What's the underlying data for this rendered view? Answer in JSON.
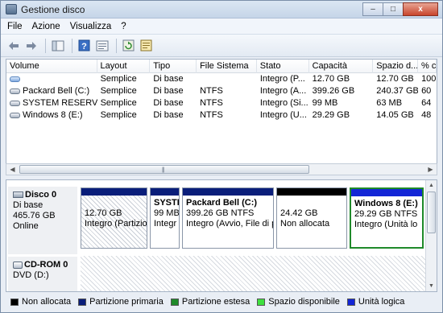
{
  "window": {
    "title": "Gestione disco",
    "min": "–",
    "max": "□",
    "close": "x"
  },
  "menu": [
    "File",
    "Azione",
    "Visualizza",
    "?"
  ],
  "toolbar": {
    "icons": [
      "back-arrow-icon",
      "forward-arrow-icon",
      "console-tree-icon",
      "help-icon",
      "properties-icon",
      "refresh-icon",
      "export-list-icon"
    ]
  },
  "volumes": {
    "headers": [
      "Volume",
      "Layout",
      "Tipo",
      "File Sistema",
      "Stato",
      "Capacità",
      "Spazio d...",
      "% c"
    ],
    "rows": [
      [
        "",
        "Semplice",
        "Di base",
        "",
        "Integro (P...",
        "12.70 GB",
        "12.70 GB",
        "100"
      ],
      [
        "Packard Bell (C:)",
        "Semplice",
        "Di base",
        "NTFS",
        "Integro (A...",
        "399.26 GB",
        "240.37 GB",
        "60"
      ],
      [
        "SYSTEM RESERVED",
        "Semplice",
        "Di base",
        "NTFS",
        "Integro (Si...",
        "99 MB",
        "63 MB",
        "64"
      ],
      [
        "Windows 8 (E:)",
        "Semplice",
        "Di base",
        "NTFS",
        "Integro (U...",
        "29.29 GB",
        "14.05 GB",
        "48"
      ]
    ]
  },
  "disk0": {
    "name": "Disco 0",
    "type": "Di base",
    "size": "465.76 GB",
    "status": "Online",
    "partitions": [
      {
        "name": "",
        "size": "12.70 GB",
        "status": "Integro (Partizio"
      },
      {
        "name": "SYSTE",
        "size": "99 MB",
        "status": "Integr"
      },
      {
        "name": "Packard Bell  (C:)",
        "size": "399.26 GB NTFS",
        "status": "Integro (Avvio, File di p"
      },
      {
        "name": "",
        "size": "24.42 GB",
        "status": "Non allocata"
      },
      {
        "name": "Windows 8  (E:)",
        "size": "29.29 GB NTFS",
        "status": "Integro (Unità lo"
      }
    ]
  },
  "cdrom": {
    "name": "CD-ROM 0",
    "drive": "DVD (D:)"
  },
  "legend": [
    {
      "label": "Non allocata",
      "color": "#000000"
    },
    {
      "label": "Partizione primaria",
      "color": "#0a1e7a"
    },
    {
      "label": "Partizione estesa",
      "color": "#1f8a2a"
    },
    {
      "label": "Spazio disponibile",
      "color": "#3fe03f"
    },
    {
      "label": "Unità logica",
      "color": "#1326d6"
    }
  ]
}
